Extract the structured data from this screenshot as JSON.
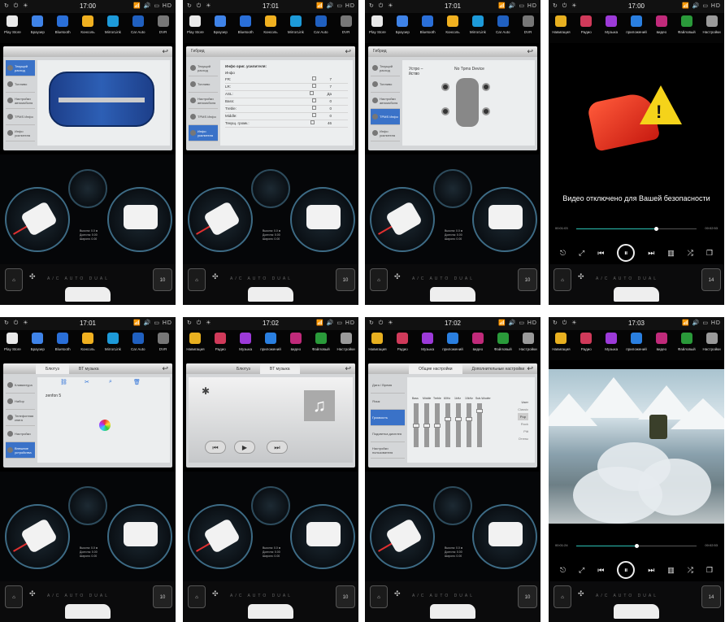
{
  "status_icons_left": "↻ ⏻ ☀",
  "status_icons_right": "📶 🔊 ▭ HD",
  "dock_a": [
    {
      "label": "Play Store",
      "icon": "play-store-icon",
      "color": "#e9e9e9"
    },
    {
      "label": "Браузер",
      "icon": "globe-icon",
      "color": "#3f83e8"
    },
    {
      "label": "Bluetooth",
      "icon": "bluetooth-icon",
      "color": "#2a6fd8"
    },
    {
      "label": "Консоль",
      "icon": "pen-icon",
      "color": "#f0b020"
    },
    {
      "label": "MirrorLink",
      "icon": "mirrorlink-icon",
      "color": "#1d9ad9"
    },
    {
      "label": "Car Auto",
      "icon": "phone-icon",
      "color": "#2060c0"
    },
    {
      "label": "DVR",
      "icon": "camera-icon",
      "color": "#777"
    }
  ],
  "dock_b": [
    {
      "label": "Навигация",
      "icon": "navigation-icon",
      "color": "#e8b020"
    },
    {
      "label": "Радио",
      "icon": "radio-icon",
      "color": "#d03a5a"
    },
    {
      "label": "Музыка",
      "icon": "music-icon",
      "color": "#9c3ad8"
    },
    {
      "label": "приложений",
      "icon": "apps-icon",
      "color": "#2a7fe0"
    },
    {
      "label": "видео",
      "icon": "video-icon",
      "color": "#c02a7a"
    },
    {
      "label": "Файловый",
      "icon": "folder-icon",
      "color": "#2a9a3a"
    },
    {
      "label": "Настройки",
      "icon": "gear-icon",
      "color": "#9a9a9a"
    }
  ],
  "screens": [
    {
      "time": "17:00",
      "volume": "10"
    },
    {
      "time": "17:01",
      "volume": "10",
      "panel_title": "Гибрид",
      "amp_title": "Инфо ориг. усилителя:",
      "amp_header": "Инфо",
      "amp_rows": [
        {
          "k": "FR:",
          "v": "7"
        },
        {
          "k": "LR:",
          "v": "7"
        },
        {
          "k": "ASL:",
          "v": "Да"
        },
        {
          "k": "Bass:",
          "v": "0"
        },
        {
          "k": "Treble:",
          "v": "0"
        },
        {
          "k": "Middle:",
          "v": "0"
        },
        {
          "k": "Текущ. громк.:",
          "v": "46"
        }
      ]
    },
    {
      "time": "17:01",
      "volume": "10",
      "panel_title": "Гибрид",
      "tpms_device": "Устро – йство",
      "tpms_status": "No Tpms Device"
    },
    {
      "time": "17:00",
      "volume": "14",
      "video_warning": "Видео отключено для Вашей безопасности",
      "elapsed": "00:01:03",
      "total": "00:02:53",
      "progress": 0.66
    },
    {
      "time": "17:01",
      "volume": "10",
      "bt_tab_1": "Блютуз",
      "bt_tab_2": "BT музыка",
      "device_name": "zenfon 5"
    },
    {
      "time": "17:02",
      "volume": "10",
      "bt_tab_1": "Блютуз",
      "bt_tab_2": "BT музыка"
    },
    {
      "time": "17:02",
      "volume": "10",
      "eq_tab_1": "Общие настройки",
      "eq_tab_2": "Дополнительные настройки",
      "eq_labels": [
        "Bass",
        "Middle",
        "Treble",
        "60Hz",
        "1kHz",
        "10kHz",
        "Sub-Woofer"
      ],
      "eq_levels": [
        0.5,
        0.5,
        0.5,
        0.35,
        0.35,
        0.35,
        0.15
      ],
      "eq_modes": [
        "User",
        "Classic",
        "Pop",
        "Rock",
        "Pitt",
        "Отелы"
      ],
      "eq_side": [
        "Дата / Время",
        "Язык",
        "Громкость",
        "Подсветка дисплея",
        "Настройки пользователя"
      ]
    },
    {
      "time": "17:03",
      "volume": "14",
      "elapsed": "00:01:24",
      "total": "00:02:53",
      "progress": 0.5
    }
  ],
  "side_menu": [
    "Текущий расход",
    "Топливо",
    "Настройки автомобиля",
    "TPMS Инфо",
    "Инфо усилителя"
  ],
  "bt_side": [
    "Клавиатура",
    "Набор",
    "Телефонная книга",
    "Настройки",
    "Внешние устройства"
  ],
  "gauge_text": "Высота: 0.0 м\nДолгота: 0.00\nШирота: 0.00",
  "climate_labels": "A/C   AUTO   DUAL"
}
